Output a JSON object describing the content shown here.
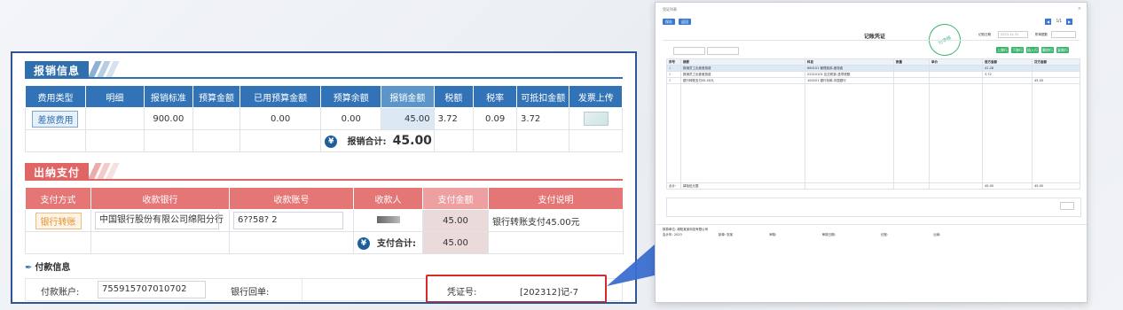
{
  "colors": {
    "blue": "#2f6fae",
    "blue_header": "#3173b6",
    "blue_highlight": "#dbe9f4",
    "red": "#e06666",
    "red_header": "#e57676",
    "red_highlight": "#eadada",
    "orange": "#e4922e",
    "frame": "#2f5597",
    "callout": "#3a6ecf"
  },
  "reimburse": {
    "title": "报销信息",
    "headers": [
      "费用类型",
      "明细",
      "报销标准",
      "预算金额",
      "已用预算金额",
      "预算余额",
      "报销金额",
      "税额",
      "税率",
      "可抵扣金额",
      "发票上传"
    ],
    "row": {
      "type": "差旅费用",
      "detail": "",
      "standard": "900.00",
      "budget": "",
      "used_budget": "0.00",
      "budget_left": "0.00",
      "amount": "45.00",
      "tax": "3.72",
      "tax_rate": "0.09",
      "deductible": "3.72"
    },
    "total_label": "报销合计:",
    "total_value": "45.00",
    "total_icon": "yen-icon"
  },
  "payment": {
    "title": "出纳支付",
    "headers": [
      "支付方式",
      "收款银行",
      "收款账号",
      "收款人",
      "支付金额",
      "支付说明"
    ],
    "row": {
      "method": "银行转账",
      "bank": "中国银行股份有限公司绵阳分行",
      "account": "6??58?                2",
      "payee": "",
      "amount": "45.00",
      "note": "银行转账支付45.00元"
    },
    "total_label": "支付合计:",
    "total_value": "45.00"
  },
  "pay_info": {
    "title": "付款信息",
    "account_label": "付款账户:",
    "account_value": "755915707010702",
    "receipt_label": "银行回单:",
    "voucher_label": "凭证号:",
    "voucher_value": "[202312]记-7"
  },
  "voucher_window": {
    "window_title": "凭证列表",
    "btn_save": "保存",
    "btn_back": "返回",
    "title": "记账凭证",
    "stamp": "已审核",
    "page": "1/1",
    "date_label": "记账日期",
    "date_value": "2023-12-31",
    "attach_label": "附单据数",
    "actions": [
      "上移行",
      "下移行",
      "插入行",
      "删除行",
      "复制行"
    ],
    "headers": [
      "序号",
      "摘要",
      "科目",
      "数量",
      "单价",
      "借方金额",
      "贷方金额"
    ],
    "rows": [
      {
        "no": "1",
        "summary": "报销员工出差差旅费",
        "account": "660101 管理费用-差旅费",
        "debit": "41.28",
        "credit": ""
      },
      {
        "no": "2",
        "summary": "报销员工出差差旅费",
        "account": "22210101 应交税费-进项税额",
        "debit": "3.72",
        "credit": ""
      },
      {
        "no": "3",
        "summary": "银行转账支付45.00元",
        "account": "100201 银行存款-中国银行",
        "debit": "",
        "credit": "45.00"
      }
    ],
    "total_label": "合计:",
    "total_text": "肆拾伍元整",
    "total_debit": "45.00",
    "total_credit": "45.00",
    "footer": {
      "company_label": "核算单位:",
      "company": "绵阳某某科技有限公司",
      "year_label": "会计年:",
      "year": "2023",
      "maker_label": "制单:",
      "maker": "张某",
      "audit_label": "审核:",
      "audit_date_label": "审核日期:",
      "book_label": "记账:",
      "cashier_label": "出纳:"
    }
  }
}
